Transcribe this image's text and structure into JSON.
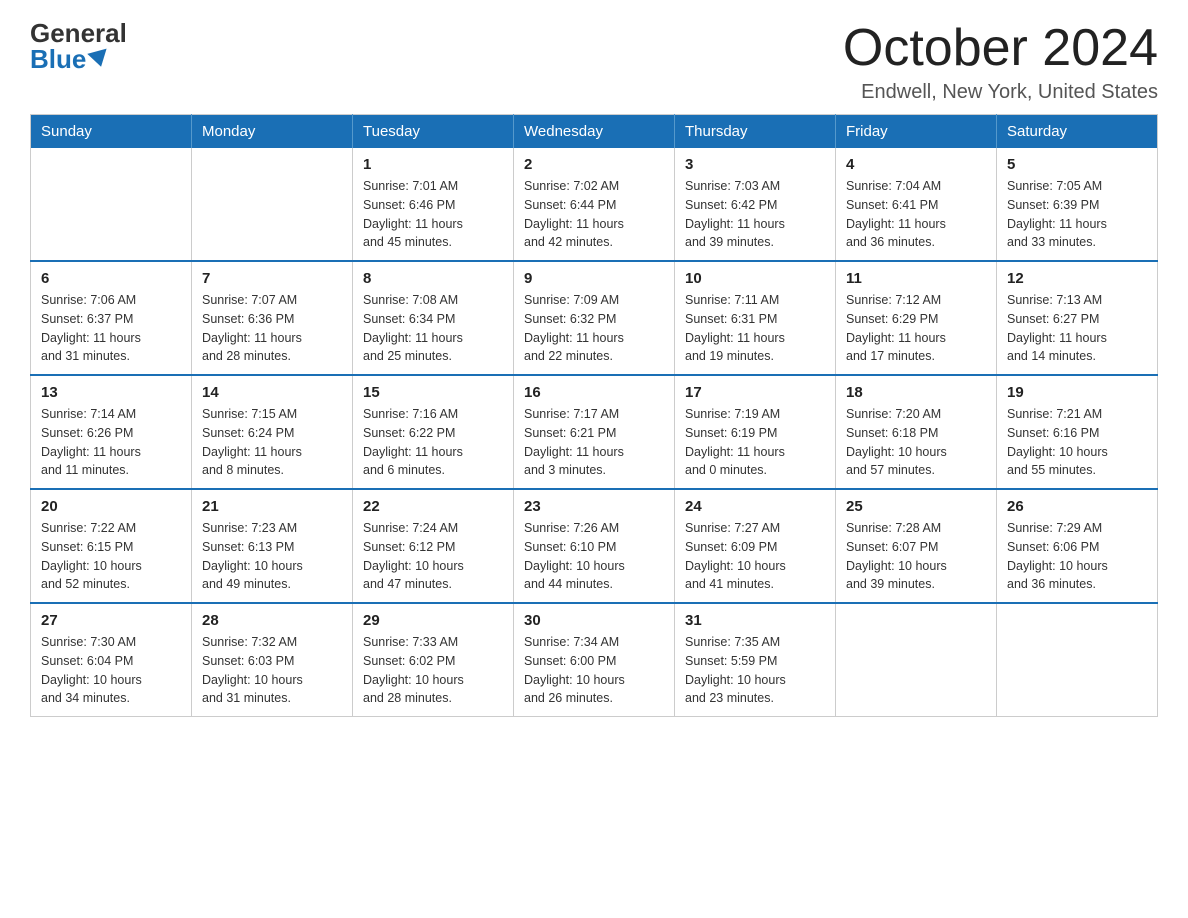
{
  "logo": {
    "general": "General",
    "blue": "Blue"
  },
  "title": "October 2024",
  "location": "Endwell, New York, United States",
  "days_of_week": [
    "Sunday",
    "Monday",
    "Tuesday",
    "Wednesday",
    "Thursday",
    "Friday",
    "Saturday"
  ],
  "weeks": [
    [
      {
        "day": "",
        "info": ""
      },
      {
        "day": "",
        "info": ""
      },
      {
        "day": "1",
        "info": "Sunrise: 7:01 AM\nSunset: 6:46 PM\nDaylight: 11 hours\nand 45 minutes."
      },
      {
        "day": "2",
        "info": "Sunrise: 7:02 AM\nSunset: 6:44 PM\nDaylight: 11 hours\nand 42 minutes."
      },
      {
        "day": "3",
        "info": "Sunrise: 7:03 AM\nSunset: 6:42 PM\nDaylight: 11 hours\nand 39 minutes."
      },
      {
        "day": "4",
        "info": "Sunrise: 7:04 AM\nSunset: 6:41 PM\nDaylight: 11 hours\nand 36 minutes."
      },
      {
        "day": "5",
        "info": "Sunrise: 7:05 AM\nSunset: 6:39 PM\nDaylight: 11 hours\nand 33 minutes."
      }
    ],
    [
      {
        "day": "6",
        "info": "Sunrise: 7:06 AM\nSunset: 6:37 PM\nDaylight: 11 hours\nand 31 minutes."
      },
      {
        "day": "7",
        "info": "Sunrise: 7:07 AM\nSunset: 6:36 PM\nDaylight: 11 hours\nand 28 minutes."
      },
      {
        "day": "8",
        "info": "Sunrise: 7:08 AM\nSunset: 6:34 PM\nDaylight: 11 hours\nand 25 minutes."
      },
      {
        "day": "9",
        "info": "Sunrise: 7:09 AM\nSunset: 6:32 PM\nDaylight: 11 hours\nand 22 minutes."
      },
      {
        "day": "10",
        "info": "Sunrise: 7:11 AM\nSunset: 6:31 PM\nDaylight: 11 hours\nand 19 minutes."
      },
      {
        "day": "11",
        "info": "Sunrise: 7:12 AM\nSunset: 6:29 PM\nDaylight: 11 hours\nand 17 minutes."
      },
      {
        "day": "12",
        "info": "Sunrise: 7:13 AM\nSunset: 6:27 PM\nDaylight: 11 hours\nand 14 minutes."
      }
    ],
    [
      {
        "day": "13",
        "info": "Sunrise: 7:14 AM\nSunset: 6:26 PM\nDaylight: 11 hours\nand 11 minutes."
      },
      {
        "day": "14",
        "info": "Sunrise: 7:15 AM\nSunset: 6:24 PM\nDaylight: 11 hours\nand 8 minutes."
      },
      {
        "day": "15",
        "info": "Sunrise: 7:16 AM\nSunset: 6:22 PM\nDaylight: 11 hours\nand 6 minutes."
      },
      {
        "day": "16",
        "info": "Sunrise: 7:17 AM\nSunset: 6:21 PM\nDaylight: 11 hours\nand 3 minutes."
      },
      {
        "day": "17",
        "info": "Sunrise: 7:19 AM\nSunset: 6:19 PM\nDaylight: 11 hours\nand 0 minutes."
      },
      {
        "day": "18",
        "info": "Sunrise: 7:20 AM\nSunset: 6:18 PM\nDaylight: 10 hours\nand 57 minutes."
      },
      {
        "day": "19",
        "info": "Sunrise: 7:21 AM\nSunset: 6:16 PM\nDaylight: 10 hours\nand 55 minutes."
      }
    ],
    [
      {
        "day": "20",
        "info": "Sunrise: 7:22 AM\nSunset: 6:15 PM\nDaylight: 10 hours\nand 52 minutes."
      },
      {
        "day": "21",
        "info": "Sunrise: 7:23 AM\nSunset: 6:13 PM\nDaylight: 10 hours\nand 49 minutes."
      },
      {
        "day": "22",
        "info": "Sunrise: 7:24 AM\nSunset: 6:12 PM\nDaylight: 10 hours\nand 47 minutes."
      },
      {
        "day": "23",
        "info": "Sunrise: 7:26 AM\nSunset: 6:10 PM\nDaylight: 10 hours\nand 44 minutes."
      },
      {
        "day": "24",
        "info": "Sunrise: 7:27 AM\nSunset: 6:09 PM\nDaylight: 10 hours\nand 41 minutes."
      },
      {
        "day": "25",
        "info": "Sunrise: 7:28 AM\nSunset: 6:07 PM\nDaylight: 10 hours\nand 39 minutes."
      },
      {
        "day": "26",
        "info": "Sunrise: 7:29 AM\nSunset: 6:06 PM\nDaylight: 10 hours\nand 36 minutes."
      }
    ],
    [
      {
        "day": "27",
        "info": "Sunrise: 7:30 AM\nSunset: 6:04 PM\nDaylight: 10 hours\nand 34 minutes."
      },
      {
        "day": "28",
        "info": "Sunrise: 7:32 AM\nSunset: 6:03 PM\nDaylight: 10 hours\nand 31 minutes."
      },
      {
        "day": "29",
        "info": "Sunrise: 7:33 AM\nSunset: 6:02 PM\nDaylight: 10 hours\nand 28 minutes."
      },
      {
        "day": "30",
        "info": "Sunrise: 7:34 AM\nSunset: 6:00 PM\nDaylight: 10 hours\nand 26 minutes."
      },
      {
        "day": "31",
        "info": "Sunrise: 7:35 AM\nSunset: 5:59 PM\nDaylight: 10 hours\nand 23 minutes."
      },
      {
        "day": "",
        "info": ""
      },
      {
        "day": "",
        "info": ""
      }
    ]
  ]
}
